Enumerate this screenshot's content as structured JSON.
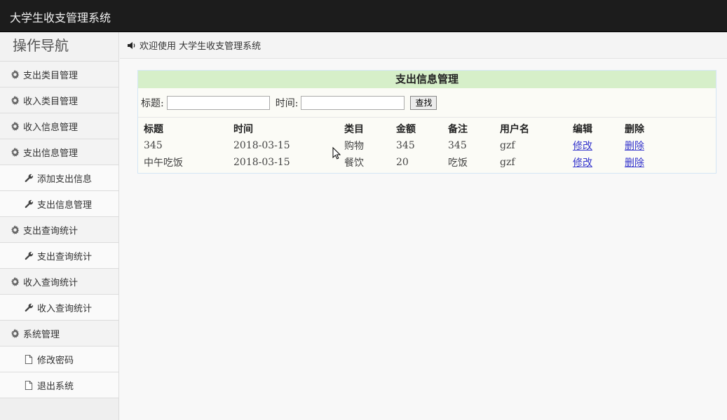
{
  "app": {
    "title": "大学生收支管理系统"
  },
  "sidebar": {
    "title": "操作导航",
    "items": [
      {
        "label": "支出类目管理",
        "icon": "gear-icon",
        "level": 1
      },
      {
        "label": "收入类目管理",
        "icon": "gear-icon",
        "level": 1
      },
      {
        "label": "收入信息管理",
        "icon": "gear-icon",
        "level": 1
      },
      {
        "label": "支出信息管理",
        "icon": "gear-icon",
        "level": 1
      },
      {
        "label": "添加支出信息",
        "icon": "wrench-icon",
        "level": 2
      },
      {
        "label": "支出信息管理",
        "icon": "wrench-icon",
        "level": 2
      },
      {
        "label": "支出查询统计",
        "icon": "gear-icon",
        "level": 1
      },
      {
        "label": "支出查询统计",
        "icon": "wrench-icon",
        "level": 2
      },
      {
        "label": "收入查询统计",
        "icon": "gear-icon",
        "level": 1
      },
      {
        "label": "收入查询统计",
        "icon": "wrench-icon",
        "level": 2
      },
      {
        "label": "系统管理",
        "icon": "gear-icon",
        "level": 1
      },
      {
        "label": "修改密码",
        "icon": "file-icon",
        "level": 2
      },
      {
        "label": "退出系统",
        "icon": "file-icon",
        "level": 2
      }
    ]
  },
  "breadcrumb": {
    "icon": "speaker-icon",
    "text": "欢迎使用 大学生收支管理系统"
  },
  "panel": {
    "title": "支出信息管理",
    "search": {
      "title_label": "标题:",
      "title_value": "",
      "time_label": "时间:",
      "time_value": "",
      "button_label": "查找"
    },
    "columns": [
      "标题",
      "时间",
      "类目",
      "金额",
      "备注",
      "用户名",
      "编辑",
      "删除"
    ],
    "rows": [
      {
        "title": "345",
        "time": "2018-03-15",
        "category": "购物",
        "amount": "345",
        "note": "345",
        "user": "gzf",
        "edit": "修改",
        "delete": "删除"
      },
      {
        "title": "中午吃饭",
        "time": "2018-03-15",
        "category": "餐饮",
        "amount": "20",
        "note": "吃饭",
        "user": "gzf",
        "edit": "修改",
        "delete": "删除"
      }
    ]
  },
  "colors": {
    "topbar": "#1c1c1c",
    "panel_title_bg": "#d6efc9",
    "link": "#3333cc"
  }
}
